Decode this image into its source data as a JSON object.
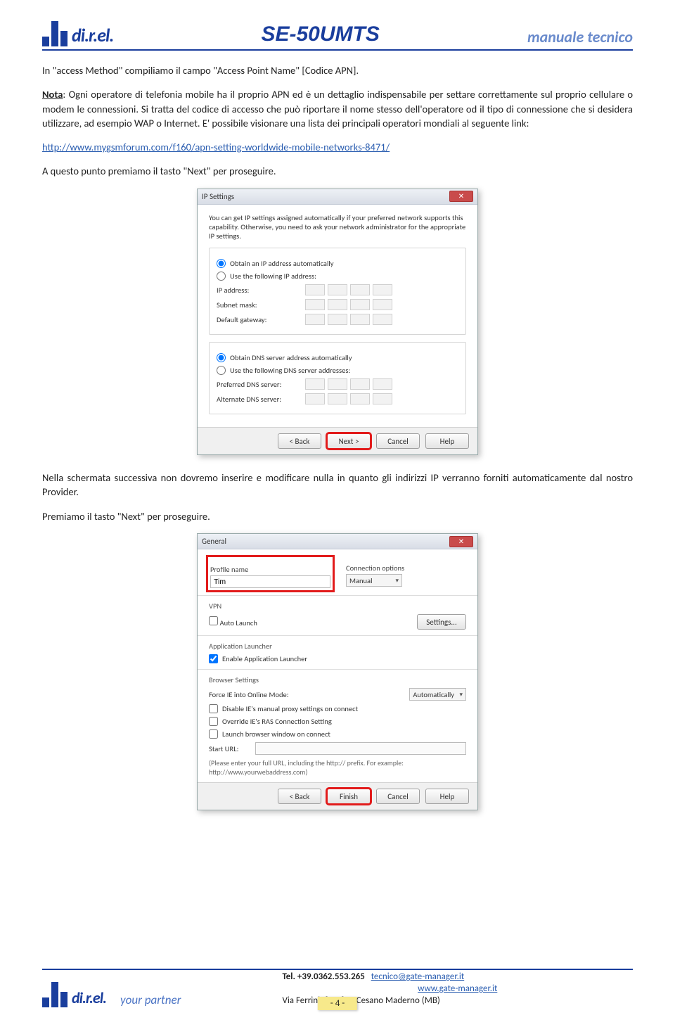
{
  "header": {
    "logo_text": "di.r.el.",
    "product": "SE-50UMTS",
    "manual": "manuale tecnico"
  },
  "body": {
    "p1": "In \"access Method\" compiliamo il campo \"Access Point Name\" [Codice APN].",
    "p2a": "Nota",
    "p2b": ": Ogni operatore di telefonia mobile ha il proprio APN ed è un dettaglio indispensabile per settare correttamente sul proprio cellulare o modem le connessioni. Si tratta del codice di accesso che può riportare il nome stesso dell'operatore od il tipo di connessione che si desidera utilizzare, ad esempio WAP o Internet. E' possibile visionare una lista dei principali operatori mondiali al seguente link:",
    "link": "http://www.mygsmforum.com/f160/apn-setting-worldwide-mobile-networks-8471/",
    "p3": "A questo punto premiamo il tasto \"Next\" per proseguire.",
    "p4": "Nella schermata successiva non dovremo inserire e modificare nulla in quanto gli indirizzi IP verranno forniti automaticamente dal nostro Provider.",
    "p5": "Premiamo il tasto \"Next\" per proseguire."
  },
  "dialog1": {
    "title": "IP Settings",
    "info": "You can get IP settings assigned automatically if your preferred network supports this capability. Otherwise, you need to ask your network administrator for the appropriate IP settings.",
    "r1": "Obtain an IP address automatically",
    "r2": "Use the following IP address:",
    "ip_label": "IP address:",
    "subnet_label": "Subnet mask:",
    "gateway_label": "Default gateway:",
    "r3": "Obtain DNS server address automatically",
    "r4": "Use the following DNS server addresses:",
    "pref_dns": "Preferred DNS server:",
    "alt_dns": "Alternate DNS server:",
    "back": "< Back",
    "next": "Next >",
    "cancel": "Cancel",
    "help": "Help"
  },
  "dialog2": {
    "title": "General",
    "profile_label": "Profile name",
    "profile_value": "Tim",
    "conn_label": "Connection options",
    "conn_value": "Manual",
    "vpn_group": "VPN",
    "auto_launch": "Auto Launch",
    "settings_btn": "Settings...",
    "app_launcher_group": "Application Launcher",
    "enable_app": "Enable Application Launcher",
    "browser_group": "Browser Settings",
    "force_ie": "Force IE into Online Mode:",
    "force_ie_value": "Automatically",
    "disable_proxy": "Disable IE's manual proxy settings on connect",
    "override_ras": "Override IE's RAS Connection Setting",
    "launch_browser": "Launch browser window on connect",
    "start_url": "Start URL:",
    "url_note": "(Please enter your full URL, including the http:// prefix. For example: http://www.yourwebaddress.com)",
    "back": "< Back",
    "finish": "Finish",
    "cancel": "Cancel",
    "help": "Help"
  },
  "footer": {
    "logo_text": "di.r.el.",
    "partner": "your partner",
    "tel_label": "Tel. +39.0362.553.265",
    "email": "tecnico@gate-manager.it",
    "site": "www.gate-manager.it",
    "addr": "Via Ferrini, 8     20811  Cesano Maderno  (MB)",
    "page": "- 4 -"
  }
}
